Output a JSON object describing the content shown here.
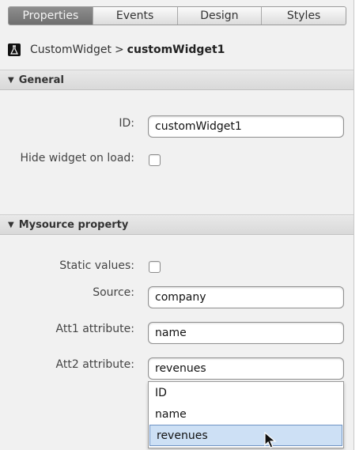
{
  "tabs": [
    {
      "label": "Properties",
      "active": true
    },
    {
      "label": "Events",
      "active": false
    },
    {
      "label": "Design",
      "active": false
    },
    {
      "label": "Styles",
      "active": false
    }
  ],
  "breadcrumb": {
    "parent": "CustomWidget",
    "separator": ">",
    "current": "customWidget1"
  },
  "general": {
    "title": "General",
    "id_label": "ID:",
    "id_value": "customWidget1",
    "hide_label": "Hide widget on load:",
    "hide_checked": false
  },
  "mysource": {
    "title": "Mysource property",
    "static_label": "Static values:",
    "static_checked": false,
    "source_label": "Source:",
    "source_value": "company",
    "att1_label": "Att1 attribute:",
    "att1_value": "name",
    "att2_label": "Att2 attribute:",
    "att2_value": "revenues"
  },
  "dropdown": {
    "options": [
      "ID",
      "name",
      "revenues"
    ],
    "selected": "revenues"
  },
  "colors": {
    "active_tab": "#7f7f7f",
    "selection": "#cde0f5"
  }
}
